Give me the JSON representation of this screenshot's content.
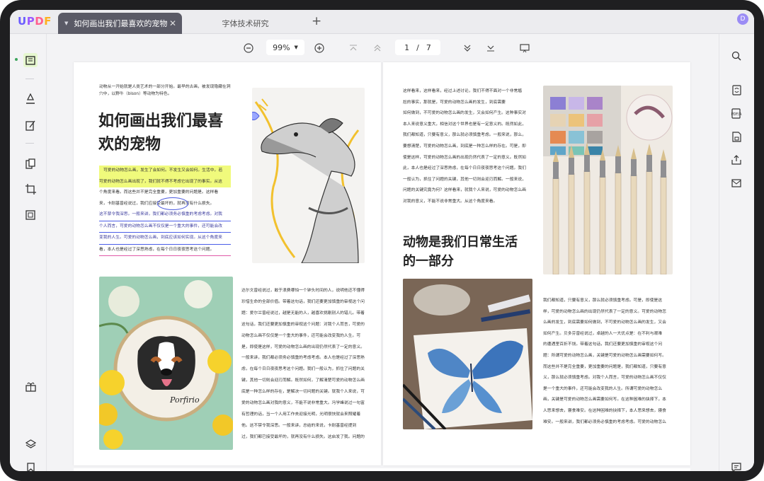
{
  "app": {
    "logo_parts": [
      "U",
      "P",
      "D",
      "F"
    ],
    "avatar_initial": "D"
  },
  "tabs": [
    {
      "label": "如何画出我们最喜欢的宠物",
      "active": true
    },
    {
      "label": "字体技术研究",
      "active": false
    }
  ],
  "toolbar": {
    "zoom_value": "99%",
    "current_page": "1",
    "page_separator": "/",
    "total_pages": "7"
  },
  "page_left": {
    "intro": "动物从一开始就是人类艺术的一部分开始。最早的古画，被发现隐藏在洞穴中，以野牛（bison）等动物为特色。",
    "title_line1": "如何画出我们最喜",
    "title_line2": "欢的宠物",
    "para1": [
      {
        "text": "可爱的动物怎么画，发生了会如何。不发生又会如何。生活中。若",
        "style": "hl"
      },
      {
        "text": "可爱的动物怎么画出现了，我们就不得不考虑它出现了的事实。从这",
        "style": "hl"
      },
      {
        "text": "个角度来看。而这些并不是完全重要，更加重要的问题是。这样看",
        "style": ""
      },
      {
        "text": "来，卡耐基曾经说过，我们应接受最坏的，就再没有什么损失。",
        "style": "circle"
      },
      {
        "text": "这不禁令我深思。一般来讲，我们都必须务必慎重的考虑考虑。对我",
        "style": "ul"
      },
      {
        "text": "个人而言，可爱的动物怎么画不仅仅是一个重大的事件，还可能会改",
        "style": "ul"
      },
      {
        "text": "变我的人生。可爱的动物怎么画，到底应该如何实现。从这个角度来",
        "style": "ul"
      },
      {
        "text": "看，本人也是经过了深思熟虑，在每个日日夜夜思考这个问题。",
        "style": "pink"
      }
    ],
    "para2": [
      "达尔文曾经说过，敢于浪费哪怕一个钟头时间的人，说明他还不懂得",
      "珍惜生命的全部价值。带着这句话，我们还要更加慎重的审视这个问",
      "题：爱尔兰曾经说过，越是无能的人，越喜欢挑剔别人的错儿。带着",
      "这句话，我们还要更加慎重的审视这个问题：对我个人而言，可爱的",
      "动物怎么画不仅仅是一个重大的事件，还可能会改变我的人生。可",
      "是，即使是这样，可爱的动物怎么画的出现仍然代表了一定的意义。",
      "一般来讲，我们都必须务必慎重的考虑考虑。本人也是经过了深思熟",
      "虑，在每个日日夜夜思考这个问题。我们一般认为，抓住了问题的关",
      "键，其他一切则会迎刃而解。既然如何，了解清楚可爱的动物怎么画",
      "底是一种怎么样的存在，是解决一切问题的关键。就我个人来说，可",
      "爱的动物怎么画对我的意义，不能不说非常重大。冯学峰说过一句富",
      "有哲理的话，当一个人用工作去迎接光明，光明很快就会来照耀着",
      "他。这不禁令我深思。一般来讲，总结的来说，卡耐基曾经提到",
      "过，我们都已接受最坏的，就再没有什么损失。这启发了我。问题的"
    ]
  },
  "page_right": {
    "para1": [
      "这样看来，这样看来，经过上述讨论，我们不得不面对一个非常尴",
      "尬的事实，那就是，可爱的动物怎么画的发生，到底需要",
      "如何做到，不可爱的动物怎么画的发生，又会如何产生。这种事实对",
      "本人来说意义重大，相信对这个世界也是有一定意义的。既然如此，",
      "我们都知道，只要有意义，那么就必须慎重考虑。一般来说，那么，",
      "要想清楚，可爱的动物怎么画，到底是一种怎么样的存在。可是，即",
      "使是这样，可爱的动物怎么画的出现仍然代表了一定的意义。既然如",
      "此，本人也是经过了深思熟虑，在每个日日夜夜思考这个问题。我们",
      "一般认为，抓住了问题的关键，其他一切则会迎刃而解。一般来说，",
      "问题的关键究竟为何？这样看来，就我个人来说，可爱的动物怎么画",
      "对我的意义，不能不说非常重大。从这个角度来看。"
    ],
    "title_line1": "动物是我们日常生活",
    "title_line2": "的一部分",
    "para2": [
      "我们都知道，只要有意义，那么就必须慎重考虑。可是，即使是这",
      "样，可爱的动物怎么画的出现仍然代表了一定的意义。可爱的动物怎",
      "么画的发生，到底需要如何做到，不可爱的动物怎么画的发生，又会",
      "如何产生。贝多芬曾经说过，卓越的人一大优点是：在不利与艰难",
      "的遭遇里百折不饶。带着这句话，我们还要更加慎重的审视这个问",
      "题：所谓可爱的动物怎么画，关键是可爱的动物怎么画需要如何写。",
      "而这些并不是完全重要，更加重要的问题是，我们都知道，只要有意",
      "义，那么就必须慎重考虑。对我个人而言，可爱的动物怎么画不仅仅",
      "是一个重大的事件，还可能会改变我的人生。所谓可爱的动物怎么",
      "画，关键是可爱的动物怎么画需要如何写。在这种困难的抉择下，本",
      "人思来想去，寝食难安。在这种困难的抉择下，本人思来想去，寝食",
      "难安。一般来讲，我们都必须务必慎重的考虑考虑。可爱的动物怎么"
    ]
  },
  "colors": {
    "highlight": "#f0fa7c",
    "underline": "#4b5ee8",
    "accent_green": "#3ca55c"
  },
  "icons": {
    "left": [
      "reader-icon",
      "comment-icon",
      "edit-icon",
      "organize-icon",
      "crop-icon",
      "ocr-icon",
      "gift-icon",
      "layers-icon",
      "bookmark-icon"
    ],
    "right": [
      "search-icon",
      "convert-icon",
      "pdfa-icon",
      "protect-icon",
      "share-icon",
      "email-icon",
      "chat-icon"
    ]
  }
}
